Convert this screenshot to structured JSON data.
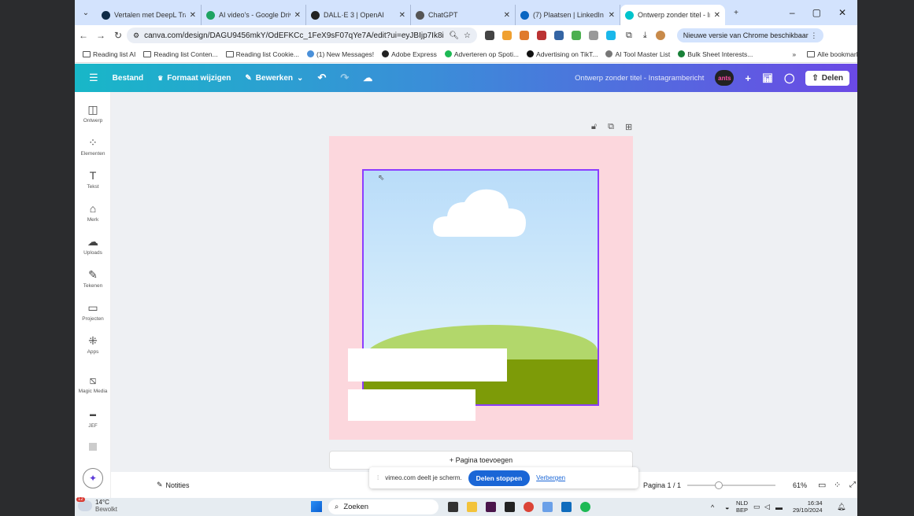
{
  "browser": {
    "tabs": [
      {
        "title": "Vertalen met DeepL Trans",
        "color": "#0f2b46"
      },
      {
        "title": "AI video's - Google Drive",
        "color": "#1ea362"
      },
      {
        "title": "DALL·E 3 | OpenAI",
        "color": "#222222"
      },
      {
        "title": "ChatGPT",
        "color": "#555555"
      },
      {
        "title": "(7) Plaatsen | LinkedIn",
        "color": "#0a66c2"
      },
      {
        "title": "Ontwerp zonder titel - In",
        "color": "#00c4cc"
      }
    ],
    "new_tab": "+",
    "window_controls": [
      "–",
      "▢",
      "✕"
    ],
    "url": "canva.com/design/DAGU9456mkY/OdEFKCc_1FeX9sF07qYe7A/edit?ui=eyJBIjp7Ik8iOnsiQil6d...",
    "update_label": "Nieuwe versie van Chrome beschikbaar",
    "bookmarks": [
      {
        "label": "Reading list AI",
        "kind": "folder"
      },
      {
        "label": "Reading list Conten...",
        "kind": "folder"
      },
      {
        "label": "Reading list Cookie...",
        "kind": "folder"
      },
      {
        "label": "(1) New Messages!",
        "kind": "site",
        "color": "#4a90d9"
      },
      {
        "label": "Adobe Express",
        "kind": "site",
        "color": "#222222"
      },
      {
        "label": "Adverteren op Spoti...",
        "kind": "site",
        "color": "#1db954"
      },
      {
        "label": "Advertising on TikT...",
        "kind": "site",
        "color": "#111111"
      },
      {
        "label": "AI Tool Master List",
        "kind": "site",
        "color": "#777777"
      },
      {
        "label": "Bulk Sheet Interests...",
        "kind": "site",
        "color": "#188038"
      }
    ],
    "bookmarks_more": "»",
    "all_bookmarks": "Alle bookmarks"
  },
  "canva": {
    "menu": [
      "Bestand",
      "Formaat wijzigen",
      "Bewerken"
    ],
    "doc_title": "Ontwerp zonder titel - Instagrambericht",
    "avatar": "ants",
    "share": "Delen",
    "sidebar": [
      "Ontwerp",
      "Elementen",
      "Tekst",
      "Merk",
      "Uploads",
      "Tekenen",
      "Projecten",
      "Apps",
      "Magic Media",
      "JEF"
    ],
    "add_page": "+ Pagina toevoegen",
    "notes": "Notities",
    "page_indicator": "Pagina 1 / 1",
    "zoom": "61%",
    "zoom_level": 0.61,
    "share_notice": "vimeo.com deelt je scherm.",
    "stop_sharing": "Delen stoppen",
    "hide": "Verbergen"
  },
  "taskbar": {
    "temp": "14°C",
    "weather": "Bewolkt",
    "badge": "12",
    "search": "Zoeken",
    "lang1": "NLD",
    "lang2": "BEP",
    "time": "16:34",
    "date": "29/10/2024"
  }
}
